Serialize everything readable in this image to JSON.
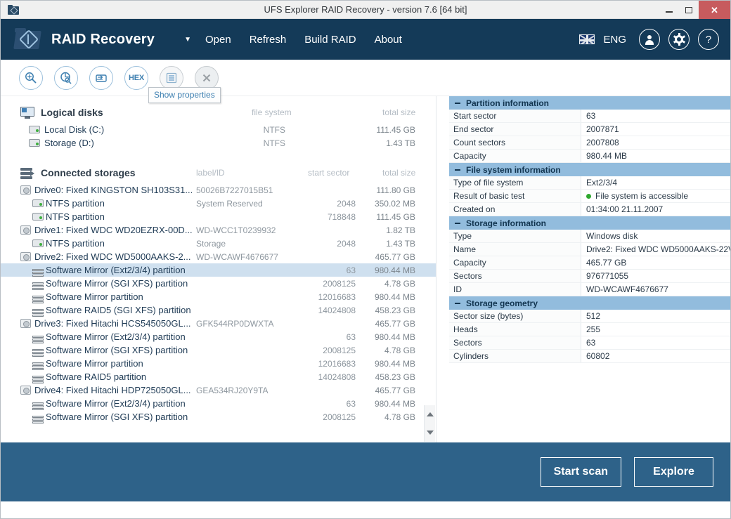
{
  "window": {
    "title": "UFS Explorer RAID Recovery - version 7.6 [64 bit]",
    "icon": "app-folder-icon",
    "controls": {
      "minimize": "–",
      "maximize": "□",
      "close": "✕"
    }
  },
  "header": {
    "app_name": "RAID Recovery",
    "caret": "▼",
    "menu": [
      {
        "label": "Open",
        "name": "menu-open"
      },
      {
        "label": "Refresh",
        "name": "menu-refresh"
      },
      {
        "label": "Build RAID",
        "name": "menu-build-raid"
      },
      {
        "label": "About",
        "name": "menu-about"
      }
    ],
    "language": "ENG",
    "flag": "uk-flag-icon",
    "icons": [
      "user-icon",
      "gear-icon",
      "help-icon"
    ]
  },
  "toolbar": {
    "buttons": [
      {
        "name": "find-icon",
        "label": ""
      },
      {
        "name": "disk-analysis-icon",
        "label": ""
      },
      {
        "name": "image-save-icon",
        "label": ""
      },
      {
        "name": "hex-viewer-icon",
        "label": "HEX"
      },
      {
        "name": "show-properties-icon",
        "label": ""
      },
      {
        "name": "close-storage-icon",
        "label": ""
      }
    ],
    "tooltip": "Show properties"
  },
  "logical_disks": {
    "title": "Logical disks",
    "icon": "monitor-icon",
    "columns": {
      "file_system": "file system",
      "total_size": "total size"
    },
    "items": [
      {
        "name": "Local Disk (C:)",
        "fs": "NTFS",
        "size": "111.45 GB",
        "icon": "drive-icon"
      },
      {
        "name": "Storage (D:)",
        "fs": "NTFS",
        "size": "1.43 TB",
        "icon": "drive-icon"
      }
    ]
  },
  "connected_storages": {
    "title": "Connected storages",
    "icon": "storage-stack-icon",
    "columns": {
      "label_id": "label/ID",
      "start_sector": "start sector",
      "total_size": "total size"
    },
    "items": [
      {
        "type": "drive",
        "name": "Drive0: Fixed KINGSTON SH103S31...",
        "meta": "50026B7227015B51",
        "start": "",
        "size": "111.80 GB",
        "selected": false
      },
      {
        "type": "part",
        "name": "NTFS partition",
        "meta": "System Reserved",
        "start": "2048",
        "size": "350.02 MB",
        "selected": false
      },
      {
        "type": "part",
        "name": "NTFS partition",
        "meta": "",
        "start": "718848",
        "size": "111.45 GB",
        "selected": false
      },
      {
        "type": "drive",
        "name": "Drive1: Fixed WDC WD20EZRX-00D...",
        "meta": "WD-WCC1T0239932",
        "start": "",
        "size": "1.82 TB",
        "selected": false
      },
      {
        "type": "part",
        "name": "NTFS partition",
        "meta": "Storage",
        "start": "2048",
        "size": "1.43 TB",
        "selected": false
      },
      {
        "type": "drive",
        "name": "Drive2: Fixed WDC WD5000AAKS-2...",
        "meta": "WD-WCAWF4676677",
        "start": "",
        "size": "465.77 GB",
        "selected": false
      },
      {
        "type": "raid",
        "name": "Software Mirror (Ext2/3/4) partition",
        "meta": "",
        "start": "63",
        "size": "980.44 MB",
        "selected": true
      },
      {
        "type": "raid",
        "name": "Software Mirror (SGI XFS) partition",
        "meta": "",
        "start": "2008125",
        "size": "4.78 GB",
        "selected": false
      },
      {
        "type": "raid",
        "name": "Software Mirror partition",
        "meta": "",
        "start": "12016683",
        "size": "980.44 MB",
        "selected": false
      },
      {
        "type": "raid",
        "name": "Software RAID5 (SGI XFS) partition",
        "meta": "",
        "start": "14024808",
        "size": "458.23 GB",
        "selected": false
      },
      {
        "type": "drive",
        "name": "Drive3: Fixed Hitachi HCS545050GL...",
        "meta": "GFK544RP0DWXTA",
        "start": "",
        "size": "465.77 GB",
        "selected": false
      },
      {
        "type": "raid",
        "name": "Software Mirror (Ext2/3/4) partition",
        "meta": "",
        "start": "63",
        "size": "980.44 MB",
        "selected": false
      },
      {
        "type": "raid",
        "name": "Software Mirror (SGI XFS) partition",
        "meta": "",
        "start": "2008125",
        "size": "4.78 GB",
        "selected": false
      },
      {
        "type": "raid",
        "name": "Software Mirror partition",
        "meta": "",
        "start": "12016683",
        "size": "980.44 MB",
        "selected": false
      },
      {
        "type": "raid",
        "name": "Software RAID5 partition",
        "meta": "",
        "start": "14024808",
        "size": "458.23 GB",
        "selected": false
      },
      {
        "type": "drive",
        "name": "Drive4: Fixed Hitachi HDP725050GL...",
        "meta": "GEA534RJ20Y9TA",
        "start": "",
        "size": "465.77 GB",
        "selected": false
      },
      {
        "type": "raid",
        "name": "Software Mirror (Ext2/3/4) partition",
        "meta": "",
        "start": "63",
        "size": "980.44 MB",
        "selected": false
      },
      {
        "type": "raid",
        "name": "Software Mirror (SGI XFS) partition",
        "meta": "",
        "start": "2008125",
        "size": "4.78 GB",
        "selected": false
      }
    ]
  },
  "properties": [
    {
      "section": "Partition information",
      "rows": [
        {
          "key": "Start sector",
          "value": "63"
        },
        {
          "key": "End sector",
          "value": "2007871"
        },
        {
          "key": "Count sectors",
          "value": "2007808"
        },
        {
          "key": "Capacity",
          "value": "980.44 MB"
        }
      ]
    },
    {
      "section": "File system information",
      "rows": [
        {
          "key": "Type of file system",
          "value": "Ext2/3/4"
        },
        {
          "key": "Result of basic test",
          "value": "File system is accessible",
          "status": "ok"
        },
        {
          "key": "Created on",
          "value": "01:34:00 21.11.2007"
        }
      ]
    },
    {
      "section": "Storage information",
      "rows": [
        {
          "key": "Type",
          "value": "Windows disk"
        },
        {
          "key": "Name",
          "value": "Drive2: Fixed WDC WD5000AAKS-22V"
        },
        {
          "key": "Capacity",
          "value": "465.77 GB"
        },
        {
          "key": "Sectors",
          "value": "976771055"
        },
        {
          "key": "ID",
          "value": "WD-WCAWF4676677"
        }
      ]
    },
    {
      "section": "Storage geometry",
      "rows": [
        {
          "key": "Sector size (bytes)",
          "value": "512"
        },
        {
          "key": "Heads",
          "value": "255"
        },
        {
          "key": "Sectors",
          "value": "63"
        },
        {
          "key": "Cylinders",
          "value": "60802"
        }
      ]
    }
  ],
  "footer": {
    "start_scan": "Start scan",
    "explore": "Explore"
  },
  "colors": {
    "header_navy": "#143a58",
    "footer_blue": "#2e6289",
    "section_blue": "#92bcdd",
    "selection": "#cfe0ef",
    "accent": "#3d7fb0",
    "status_ok": "#2fa82f",
    "close_red": "#c75b5e"
  }
}
